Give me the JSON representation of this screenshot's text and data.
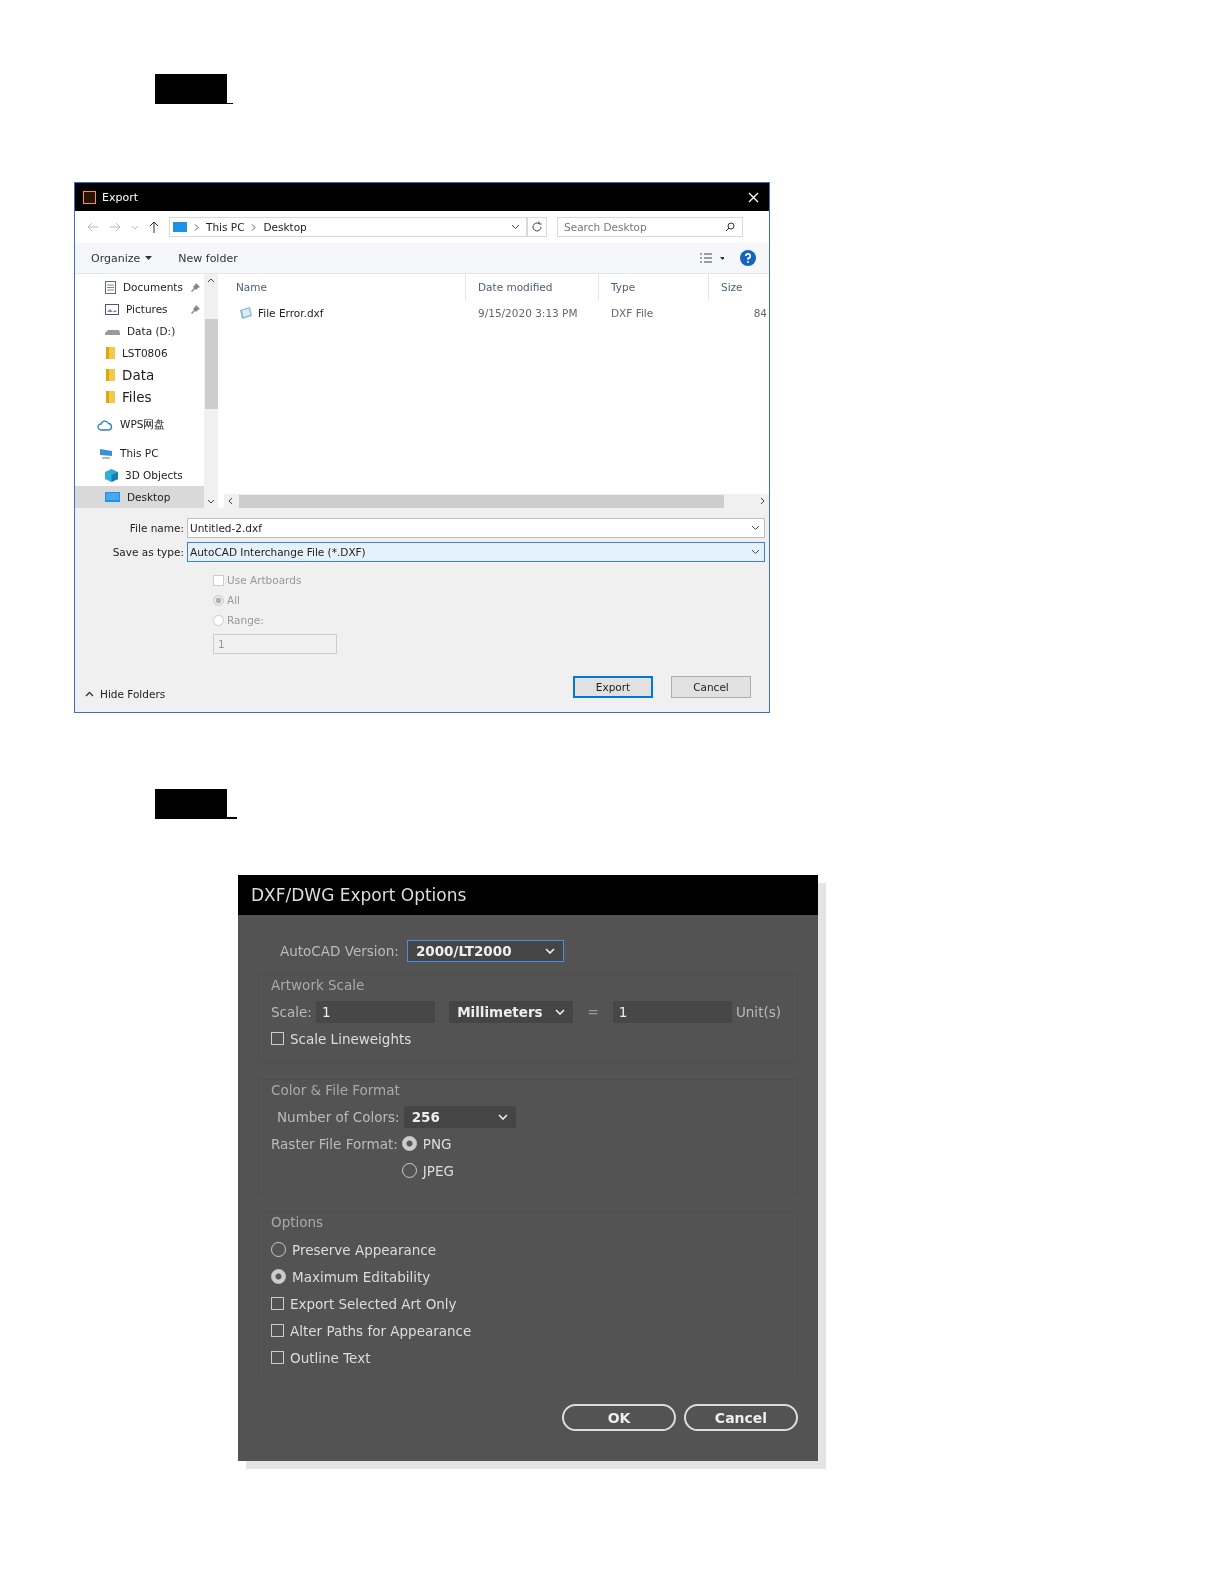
{
  "export_dialog": {
    "title": "Export",
    "address": {
      "crumbs": [
        "This PC",
        "Desktop"
      ]
    },
    "search": {
      "placeholder": "Search Desktop"
    },
    "toolbar": {
      "organize": "Organize",
      "new_folder": "New folder"
    },
    "sidebar": {
      "items": [
        {
          "label": "Documents",
          "kind": "document",
          "pinned": true,
          "selected": false
        },
        {
          "label": "Pictures",
          "kind": "picture",
          "pinned": true,
          "selected": false
        },
        {
          "label": "Data (D:)",
          "kind": "drive",
          "pinned": false,
          "selected": false
        },
        {
          "label": "LST0806",
          "kind": "folder",
          "pinned": false,
          "selected": false
        },
        {
          "label": "Data",
          "kind": "folder-large",
          "pinned": false,
          "selected": false
        },
        {
          "label": "Files",
          "kind": "folder-large",
          "pinned": false,
          "selected": false
        },
        {
          "label": "WPS网盘",
          "kind": "cloud",
          "pinned": false,
          "selected": false
        },
        {
          "label": "This PC",
          "kind": "computer",
          "pinned": false,
          "selected": false
        },
        {
          "label": "3D Objects",
          "kind": "cube",
          "pinned": false,
          "selected": false
        },
        {
          "label": "Desktop",
          "kind": "desktop",
          "pinned": false,
          "selected": true
        }
      ]
    },
    "table": {
      "columns": [
        "Name",
        "Date modified",
        "Type",
        "Size"
      ],
      "rows": [
        {
          "name": "File Error.dxf",
          "date": "9/15/2020 3:13 PM",
          "type": "DXF File",
          "size": "84"
        }
      ]
    },
    "file_name": {
      "label": "File name:",
      "value": "Untitled-2.dxf"
    },
    "save_as_type": {
      "label": "Save as type:",
      "value": "AutoCAD Interchange File (*.DXF)"
    },
    "use_artboards": {
      "label": "Use Artboards",
      "checked": false,
      "disabled": true
    },
    "range_options": [
      {
        "label": "All",
        "selected": true
      },
      {
        "label": "Range:",
        "selected": false
      }
    ],
    "range_field": {
      "value": "1"
    },
    "hide_folders": "Hide Folders",
    "buttons": [
      "Export",
      "Cancel"
    ]
  },
  "options_dialog": {
    "title": "DXF/DWG Export Options",
    "version": {
      "label": "AutoCAD Version:",
      "value": "2000/LT2000"
    },
    "artwork_scale": {
      "heading": "Artwork Scale",
      "scale_label": "Scale:",
      "scale_value": "1",
      "unit": "Millimeters",
      "equals": "=",
      "units_value": "1",
      "units_label": "Unit(s)",
      "scale_lineweights": {
        "label": "Scale Lineweights",
        "checked": false
      }
    },
    "color_format": {
      "heading": "Color & File Format",
      "colors_label": "Number of Colors:",
      "colors_value": "256",
      "raster_label": "Raster File Format:",
      "raster_options": [
        {
          "label": "PNG",
          "selected": true
        },
        {
          "label": "JPEG",
          "selected": false
        }
      ]
    },
    "options": {
      "heading": "Options",
      "items": [
        {
          "label": "Preserve Appearance",
          "kind": "radio",
          "checked": false
        },
        {
          "label": "Maximum Editability",
          "kind": "radio",
          "checked": true
        },
        {
          "label": "Export Selected Art Only",
          "kind": "checkbox",
          "checked": false
        },
        {
          "label": "Alter Paths for Appearance",
          "kind": "checkbox",
          "checked": false
        },
        {
          "label": "Outline Text",
          "kind": "checkbox",
          "checked": false
        }
      ]
    },
    "buttons": [
      "OK",
      "Cancel"
    ]
  }
}
